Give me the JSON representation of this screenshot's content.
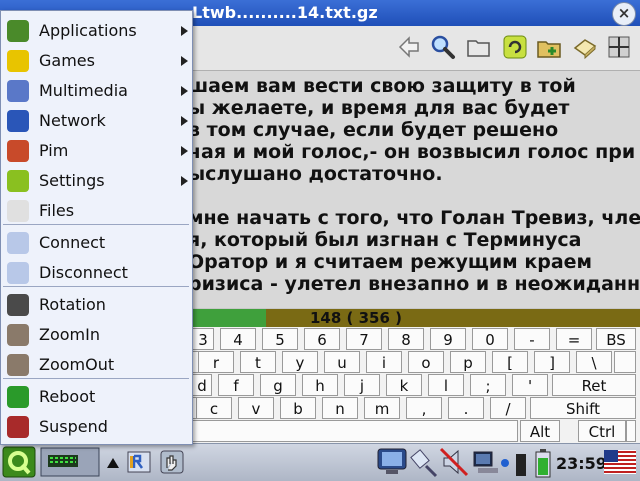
{
  "window": {
    "title": "Ltwb..........14.txt.gz",
    "close_label": "×"
  },
  "toolbar": {
    "icons": [
      "back-arrow-icon",
      "search-icon",
      "open-folder-icon",
      "refresh-icon",
      "add-folder-icon",
      "bookmark-icon",
      "fullscreen-icon"
    ]
  },
  "reader": {
    "lines": [
      "шаем вам вести свою защиту в той",
      "ы желаете, и время для вас будет",
      " в том случае, если будет решено",
      "чая и мой голос,- он возвысил голос при",
      "ыслушано достаточно.",
      "",
      "мне начать с того, что Голан Тревиз, член",
      "я, который был изгнан с Терминуса",
      " Оратор и я считаем режущим краем",
      "ризиса - улетел внезапно и в неожиданном"
    ]
  },
  "progress": {
    "label": "148 ( 356 )",
    "fraction": 0.415
  },
  "keyboard": {
    "row1": [
      "3",
      "4",
      "5",
      "6",
      "7",
      "8",
      "9",
      "0",
      "-",
      "=",
      "BS"
    ],
    "row2": [
      "r",
      "t",
      "y",
      "u",
      "i",
      "o",
      "p",
      "[",
      "]",
      "\\"
    ],
    "row3": [
      "d",
      "f",
      "g",
      "h",
      "j",
      "k",
      "l",
      ";",
      "'",
      "Ret"
    ],
    "row4": [
      "c",
      "v",
      "b",
      "n",
      "m",
      ",",
      ".",
      "/",
      "Shift"
    ],
    "row5": [
      "Alt",
      "Ctrl"
    ]
  },
  "menu": {
    "items": [
      {
        "label": "Applications",
        "icon": "applications-icon",
        "submenu": true,
        "color": "#4a8a2a"
      },
      {
        "label": "Games",
        "icon": "games-smiley-icon",
        "submenu": true,
        "color": "#e8c400"
      },
      {
        "label": "Multimedia",
        "icon": "multimedia-note-icon",
        "submenu": true,
        "color": "#5a78c8"
      },
      {
        "label": "Network",
        "icon": "network-globe-icon",
        "submenu": true,
        "color": "#2a56b8"
      },
      {
        "label": "Pim",
        "icon": "pim-calendar-icon",
        "submenu": true,
        "color": "#c84a2a"
      },
      {
        "label": "Settings",
        "icon": "settings-icon",
        "submenu": true,
        "color": "#8ac020"
      },
      {
        "label": "Files",
        "icon": "files-document-icon",
        "submenu": false,
        "color": "#e0e0e0"
      },
      {
        "label": "Connect",
        "icon": "connect-plug-icon",
        "submenu": false,
        "color": "#b8c8e8"
      },
      {
        "label": "Disconnect",
        "icon": "disconnect-plug-icon",
        "submenu": false,
        "color": "#b8c8e8"
      },
      {
        "label": "Rotation",
        "icon": "rotation-icon",
        "submenu": false,
        "color": "#4a4a4a"
      },
      {
        "label": "ZoomIn",
        "icon": "zoom-in-icon",
        "submenu": false,
        "color": "#8a7a6a"
      },
      {
        "label": "ZoomOut",
        "icon": "zoom-out-icon",
        "submenu": false,
        "color": "#8a7a6a"
      },
      {
        "label": "Reboot",
        "icon": "reboot-icon",
        "submenu": false,
        "color": "#2a9a2a"
      },
      {
        "label": "Suspend",
        "icon": "suspend-icon",
        "submenu": false,
        "color": "#a82a2a"
      }
    ]
  },
  "taskbar": {
    "clock": "23:59",
    "icons": [
      "start-q-icon",
      "keyboard-applet-icon",
      "up-arrow-icon",
      "reader-app-icon",
      "hand-icon",
      "display-icon",
      "network-plug-icon",
      "mute-speaker-icon",
      "pc-icon",
      "battery-icon",
      "us-flag-icon"
    ]
  }
}
